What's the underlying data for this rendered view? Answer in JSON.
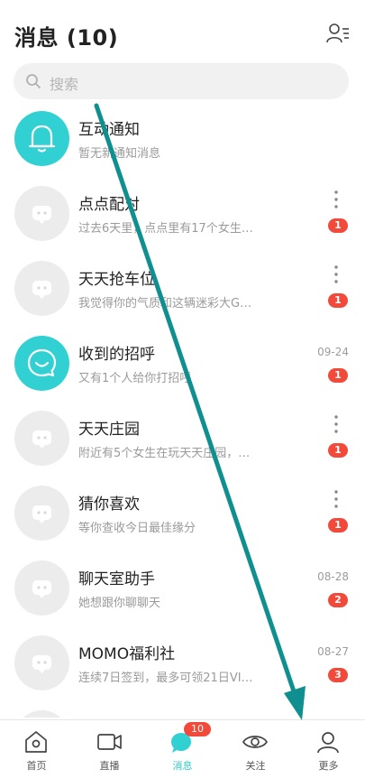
{
  "header": {
    "title": "消息 (10)",
    "contacts_icon": "contacts-icon"
  },
  "search": {
    "placeholder": "搜索",
    "icon": "search-icon"
  },
  "conversations": [
    {
      "name": "互动通知",
      "preview": "暂无新通知消息",
      "time": "",
      "badge": "",
      "avatar": "bell-icon",
      "has_menu": false
    },
    {
      "name": "点点配对",
      "preview": "过去6天里，点点里有17个女生…",
      "time": "",
      "badge": "1",
      "avatar": "chat-placeholder-icon",
      "has_menu": true
    },
    {
      "name": "天天抢车位",
      "preview": "我觉得你的气质和这辆迷彩大G…",
      "time": "",
      "badge": "1",
      "avatar": "chat-placeholder-icon",
      "has_menu": true
    },
    {
      "name": "收到的招呼",
      "preview": "又有1个人给你打招呼",
      "time": "09-24",
      "badge": "1",
      "avatar": "smile-bubble-icon",
      "has_menu": false
    },
    {
      "name": "天天庄园",
      "preview": "附近有5个女生在玩天天庄园，…",
      "time": "",
      "badge": "1",
      "avatar": "chat-placeholder-icon",
      "has_menu": true
    },
    {
      "name": "猜你喜欢",
      "preview": "等你查收今日最佳缘分",
      "time": "",
      "badge": "1",
      "avatar": "chat-placeholder-icon",
      "has_menu": true
    },
    {
      "name": "聊天室助手",
      "preview": "她想跟你聊聊天",
      "time": "08-28",
      "badge": "2",
      "avatar": "chat-placeholder-icon",
      "has_menu": false
    },
    {
      "name": "MOMO福利社",
      "preview": "连续7日签到，最多可领21日VI…",
      "time": "08-27",
      "badge": "3",
      "avatar": "chat-placeholder-icon",
      "has_menu": false
    }
  ],
  "tabbar": {
    "tabs": [
      {
        "label": "首页",
        "icon": "home-icon"
      },
      {
        "label": "直播",
        "icon": "video-camera-icon"
      },
      {
        "label": "消息",
        "icon": "message-icon",
        "badge": "10"
      },
      {
        "label": "关注",
        "icon": "eye-icon"
      },
      {
        "label": "更多",
        "icon": "profile-icon"
      }
    ],
    "active_color": "#31c9c9"
  },
  "colors": {
    "accent": "#31d1d3",
    "badge": "#f24a3a",
    "arrow": "#0f8f8f"
  }
}
